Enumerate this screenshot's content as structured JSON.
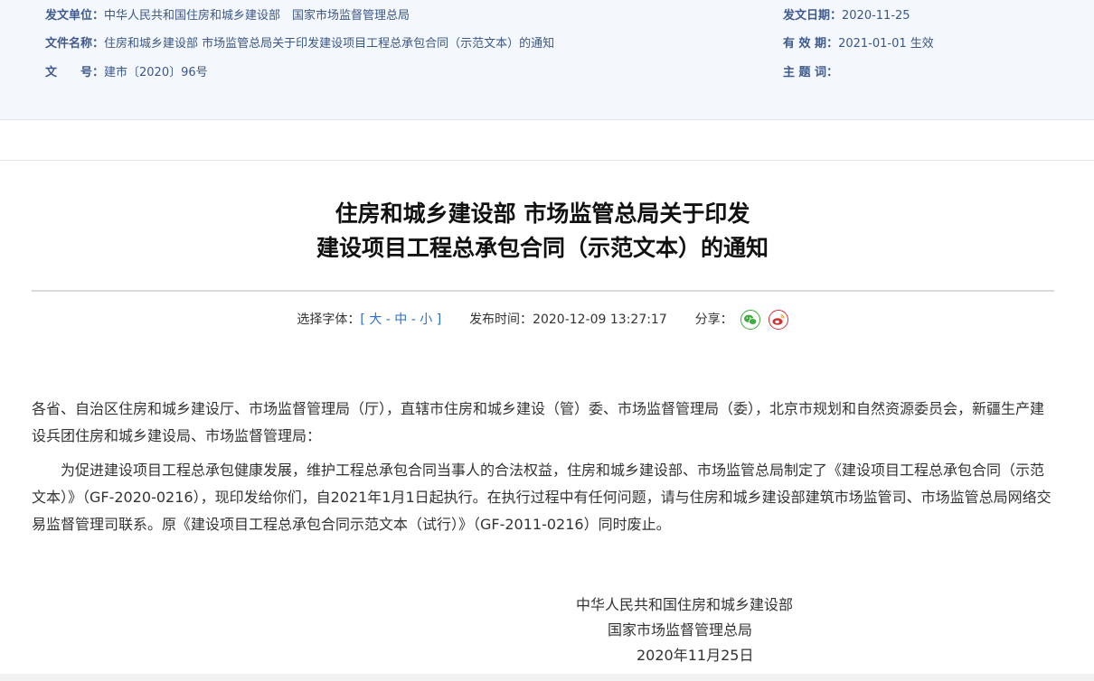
{
  "meta": {
    "issuer_label": "发文单位：",
    "issuer_value": "中华人民共和国住房和城乡建设部　国家市场监督管理总局",
    "doc_name_label": "文件名称：",
    "doc_name_value": "住房和城乡建设部 市场监管总局关于印发建设项目工程总承包合同（示范文本）的通知",
    "doc_no_label": "文　　号：",
    "doc_no_value": "建市〔2020〕96号",
    "date_label": "发文日期：",
    "date_value": "2020-11-25",
    "validity_label": "有 效 期：",
    "validity_value": "2021-01-01 生效",
    "subject_label": "主 题 词：",
    "subject_value": ""
  },
  "title": {
    "line1": "住房和城乡建设部 市场监管总局关于印发",
    "line2": "建设项目工程总承包合同（示范文本）的通知"
  },
  "toolbar": {
    "font_label": "选择字体：",
    "bracket_open": "[",
    "font_large": "大",
    "sep1": " - ",
    "font_medium": "中",
    "sep2": " - ",
    "font_small": "小",
    "bracket_close": "]",
    "publish_label": "发布时间：",
    "publish_time": "2020-12-09 13:27:17",
    "share_label": "分享：",
    "wechat_icon": "wechat-icon",
    "weibo_icon": "weibo-icon"
  },
  "body": {
    "para1": "各省、自治区住房和城乡建设厅、市场监督管理局（厅），直辖市住房和城乡建设（管）委、市场监督管理局（委），北京市规划和自然资源委员会，新疆生产建设兵团住房和城乡建设局、市场监督管理局：",
    "para2": "为促进建设项目工程总承包健康发展，维护工程总承包合同当事人的合法权益，住房和城乡建设部、市场监管总局制定了《建设项目工程总承包合同（示范文本）》（GF-2020-0216），现印发给你们，自2021年1月1日起执行。在执行过程中有任何问题，请与住房和城乡建设部建筑市场监管司、市场监管总局网络交易监督管理司联系。原《建设项目工程总承包合同示范文本（试行）》（GF-2011-0216）同时废止。"
  },
  "signature": {
    "line1": "中华人民共和国住房和城乡建设部",
    "line2": "国家市场监督管理总局",
    "line3": "2020年11月25日"
  },
  "colors": {
    "meta_bg": "#f4f7fc",
    "meta_label": "#3e5a8c",
    "link_blue": "#2a6fc9",
    "wechat_green": "#3dab3d",
    "weibo_red": "#d0322e"
  }
}
